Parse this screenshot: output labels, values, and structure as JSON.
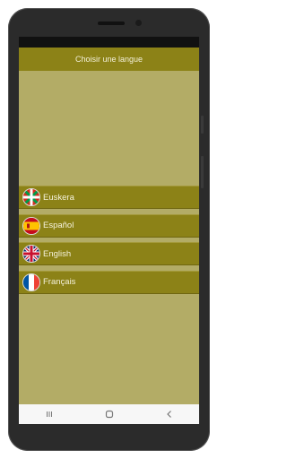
{
  "app": {
    "header_title": "Choisir une langue"
  },
  "languages": [
    {
      "label": "Euskera",
      "flag_icon": "basque-flag-icon"
    },
    {
      "label": "Español",
      "flag_icon": "spain-flag-icon"
    },
    {
      "label": "English",
      "flag_icon": "uk-flag-icon"
    },
    {
      "label": "Français",
      "flag_icon": "france-flag-icon"
    }
  ],
  "navigation": {
    "buttons": [
      "recent-apps-icon",
      "home-icon",
      "back-icon"
    ]
  },
  "colors": {
    "header": "#8c8217",
    "background": "#b3ac66",
    "item": "#8c8217",
    "text": "#f5f2dc"
  }
}
